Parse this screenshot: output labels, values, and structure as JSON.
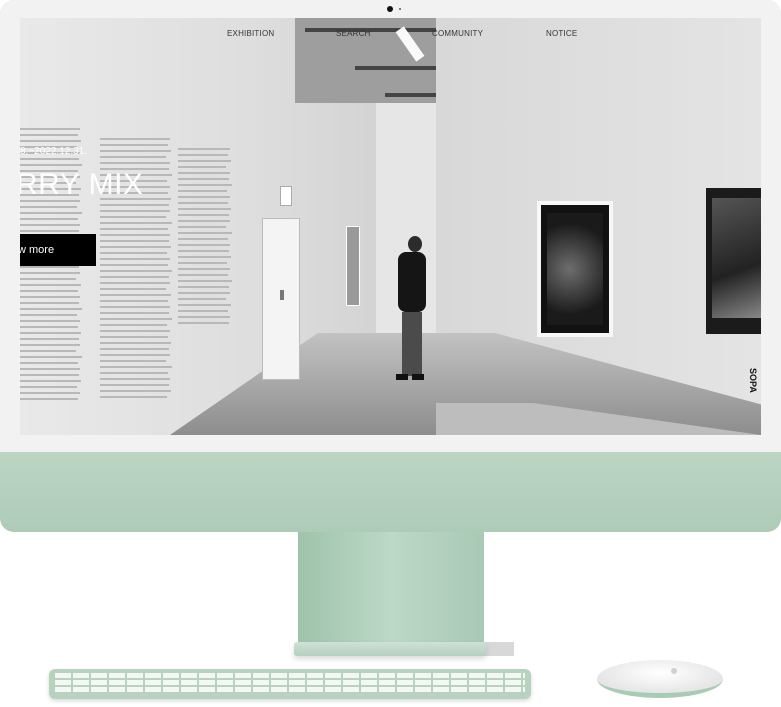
{
  "nav": {
    "items": [
      "EXHIBITION",
      "SEARCH",
      "COMMUNITY",
      "NOTICE"
    ]
  },
  "hero": {
    "date": "8.~2022.12.31.",
    "title": "RRY MIX",
    "button_label": "w more"
  },
  "side_text": "SOPA",
  "colors": {
    "device_accent": "#aecbb8",
    "bezel": "#f2f2f2",
    "button_bg": "#000000",
    "hero_text": "#ffffff"
  }
}
